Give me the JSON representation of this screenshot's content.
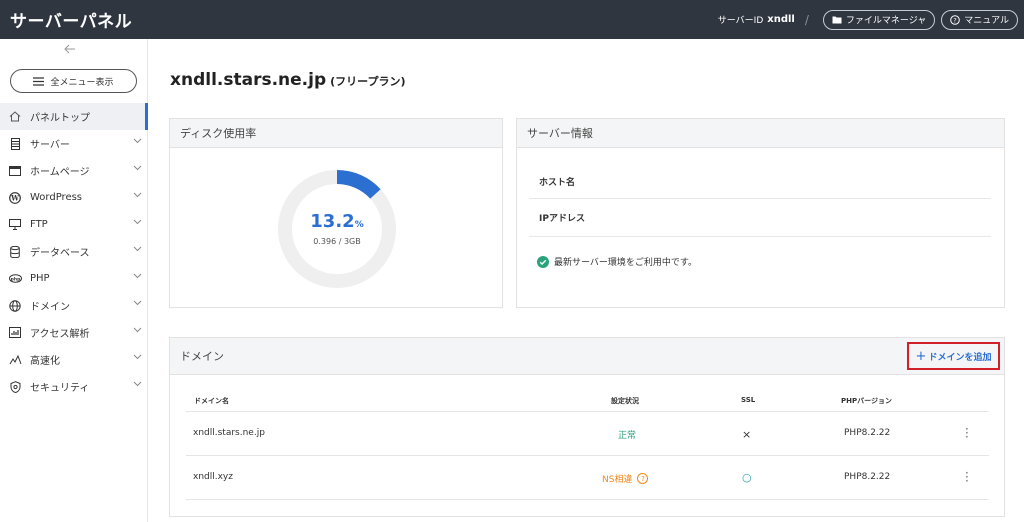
{
  "header": {
    "brand": "サーバーパネル",
    "server_id_label": "サーバーID",
    "server_id": "xndll",
    "separator": "/",
    "file_manager": "ファイルマネージャ",
    "manual": "マニュアル"
  },
  "sidebar": {
    "all_menu": "全メニュー表示",
    "items": [
      {
        "label": "パネルトップ",
        "icon": "home-icon"
      },
      {
        "label": "サーバー",
        "icon": "server-icon"
      },
      {
        "label": "ホームページ",
        "icon": "window-icon"
      },
      {
        "label": "WordPress",
        "icon": "wordpress-icon"
      },
      {
        "label": "FTP",
        "icon": "monitor-icon"
      },
      {
        "label": "データベース",
        "icon": "database-icon"
      },
      {
        "label": "PHP",
        "icon": "php-icon"
      },
      {
        "label": "ドメイン",
        "icon": "globe-icon"
      },
      {
        "label": "アクセス解析",
        "icon": "chart-icon"
      },
      {
        "label": "高速化",
        "icon": "speed-icon"
      },
      {
        "label": "セキュリティ",
        "icon": "shield-icon"
      }
    ]
  },
  "main": {
    "title": "xndll.stars.ne.jp",
    "plan": "(フリープラン)",
    "disk": {
      "heading": "ディスク使用率",
      "percent": "13.2",
      "percent_unit": "%",
      "usage": "0.396 / 3GB",
      "fraction": 0.132
    },
    "server_info": {
      "heading": "サーバー情報",
      "host_label": "ホスト名",
      "ip_label": "IPアドレス",
      "status": "最新サーバー環境をご利用中です。"
    },
    "domain": {
      "heading": "ドメイン",
      "add_button": "ドメインを追加",
      "columns": [
        "ドメイン名",
        "設定状況",
        "SSL",
        "PHPバージョン"
      ],
      "rows": [
        {
          "name": "xndll.stars.ne.jp",
          "status": "正常",
          "ssl": "×",
          "php": "PHP8.2.22"
        },
        {
          "name": "xndll.xyz",
          "status": "NS相違",
          "ssl": "○",
          "php": "PHP8.2.22"
        }
      ]
    }
  },
  "colors": {
    "accent": "#2b6fd1",
    "header_bg": "#2f3640",
    "ok": "#2aa37a",
    "warn": "#f0891a",
    "highlight": "#d0202a"
  }
}
